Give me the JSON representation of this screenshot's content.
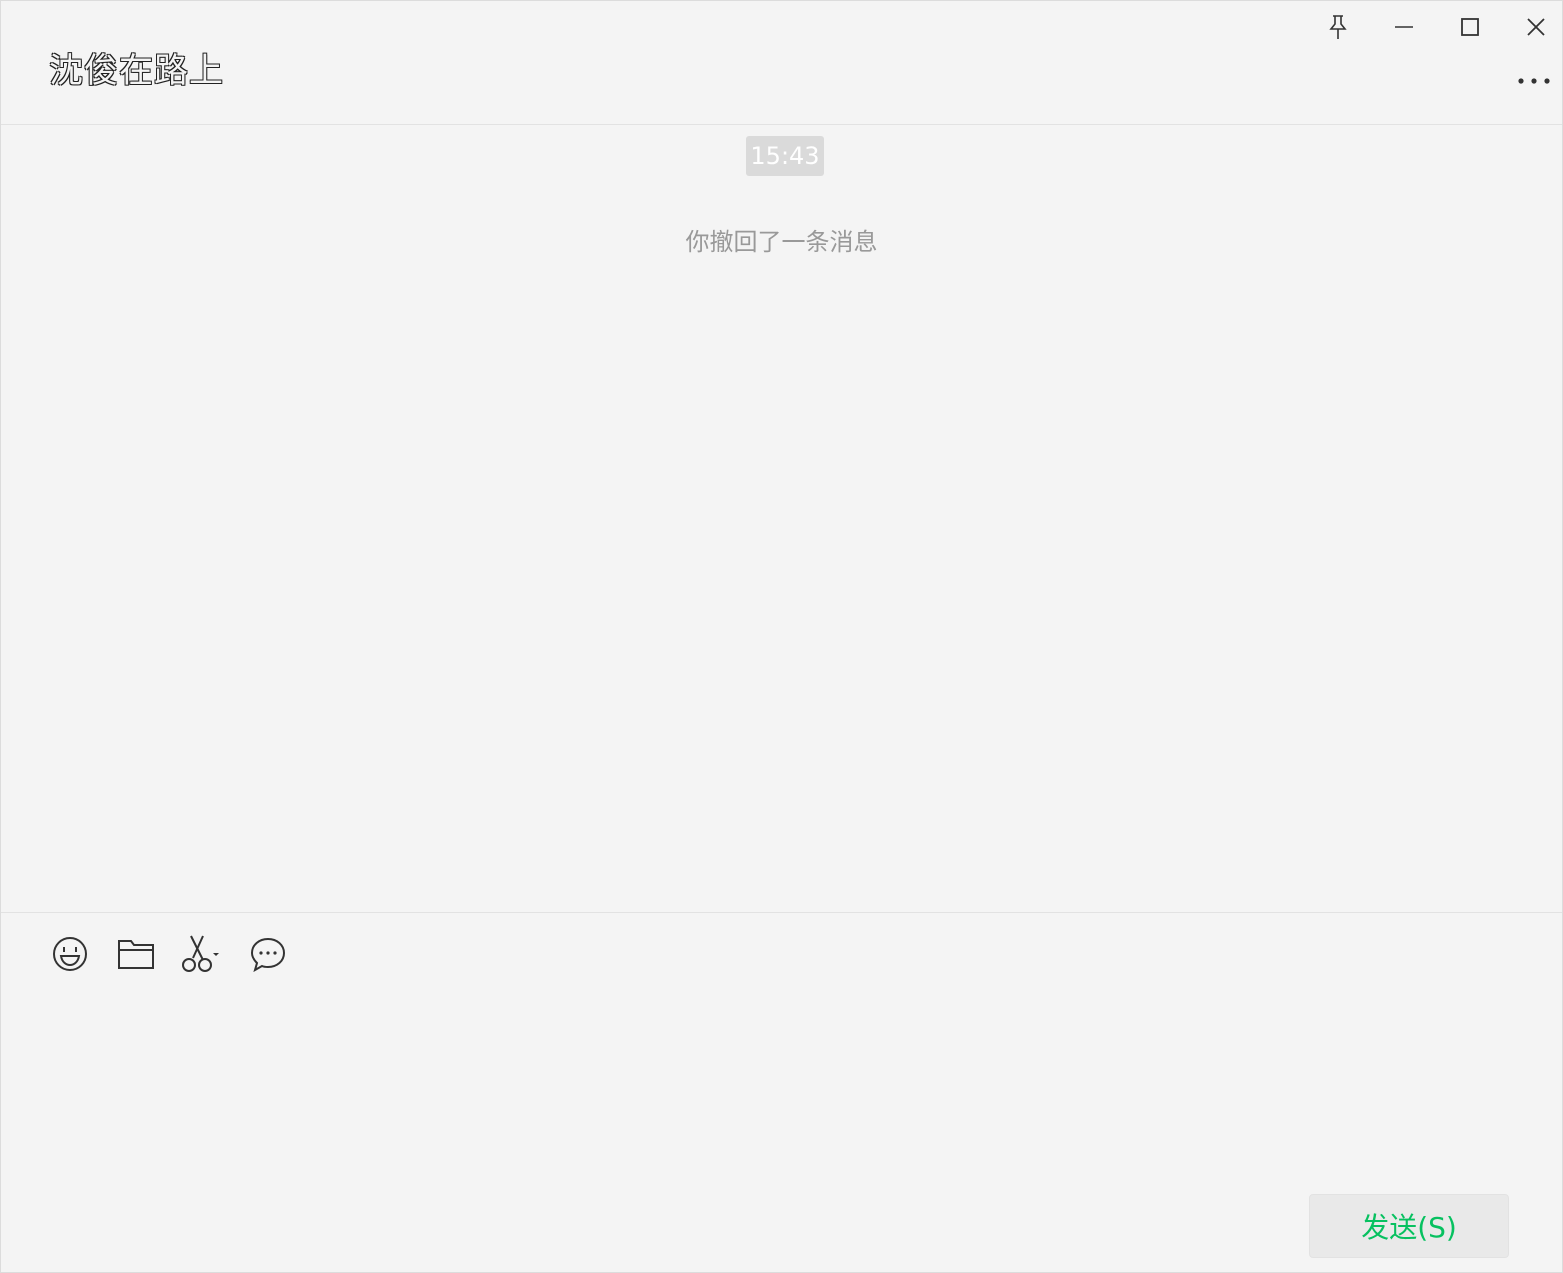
{
  "header": {
    "title": "沈俊在路上",
    "window_controls": [
      {
        "name": "pin-icon"
      },
      {
        "name": "minimize-icon"
      },
      {
        "name": "maximize-icon"
      },
      {
        "name": "close-icon"
      }
    ],
    "more_icon": "more-icon"
  },
  "messages": {
    "time": "15:43",
    "system_notice": "你撤回了一条消息"
  },
  "input": {
    "toolbar": [
      {
        "name": "emoji-icon"
      },
      {
        "name": "folder-icon"
      },
      {
        "name": "screenshot-icon"
      },
      {
        "name": "chat-history-icon"
      }
    ],
    "value": "",
    "send_label": "发送(S)"
  },
  "colors": {
    "background": "#f4f4f4",
    "accent": "#07c160",
    "muted_text": "#999999",
    "time_badge": "#dadada"
  }
}
